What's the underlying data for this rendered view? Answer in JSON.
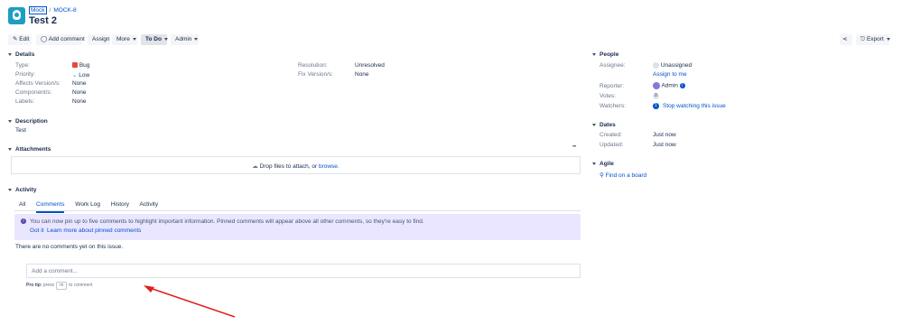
{
  "header": {
    "project": "Mock",
    "issue_key": "MOCK-8",
    "title": "Test 2"
  },
  "toolbar": {
    "edit": "Edit",
    "add_comment": "Add comment",
    "assign": "Assign",
    "more": "More",
    "status": "To Do",
    "admin": "Admin",
    "export": "Export"
  },
  "details": {
    "heading": "Details",
    "type_label": "Type:",
    "type_value": "Bug",
    "priority_label": "Priority:",
    "priority_value": "Low",
    "affects_label": "Affects Version/s:",
    "affects_value": "None",
    "component_label": "Component/s:",
    "component_value": "None",
    "labels_label": "Labels:",
    "labels_value": "None",
    "resolution_label": "Resolution:",
    "resolution_value": "Unresolved",
    "fix_label": "Fix Version/s:",
    "fix_value": "None"
  },
  "description": {
    "heading": "Description",
    "text": "Test"
  },
  "attachments": {
    "heading": "Attachments",
    "more": "•••",
    "drop_text": "Drop files to attach, or ",
    "browse": "browse."
  },
  "activity": {
    "heading": "Activity",
    "tabs": [
      "All",
      "Comments",
      "Work Log",
      "History",
      "Activity"
    ],
    "banner_text": "You can now pin up to five comments to highlight important information. Pinned comments will appear above all other comments, so they're easy to find.",
    "got_it": "Got it",
    "learn_more": "Learn more about pinned comments",
    "no_comments": "There are no comments yet on this issue.",
    "comment_placeholder": "Add a comment...",
    "pro_tip_label": "Pro tip:",
    "pro_tip_press": "press",
    "pro_tip_key": "m",
    "pro_tip_end": "to comment"
  },
  "people": {
    "heading": "People",
    "assignee_label": "Assignee:",
    "assignee_value": "Unassigned",
    "assign_to_me": "Assign to me",
    "reporter_label": "Reporter:",
    "reporter_value": "Admin",
    "votes_label": "Votes:",
    "votes_count": "0",
    "watchers_label": "Watchers:",
    "watchers_count": "1",
    "stop_watching": "Stop watching this issue"
  },
  "dates": {
    "heading": "Dates",
    "created_label": "Created:",
    "created_value": "Just now",
    "updated_label": "Updated:",
    "updated_value": "Just now"
  },
  "agile": {
    "heading": "Agile",
    "find_on_board": "Find on a board"
  },
  "colors": {
    "accent": "#0052cc",
    "arrow": "#e0201c",
    "bug": "#e5493a",
    "banner": "#eae6ff"
  }
}
